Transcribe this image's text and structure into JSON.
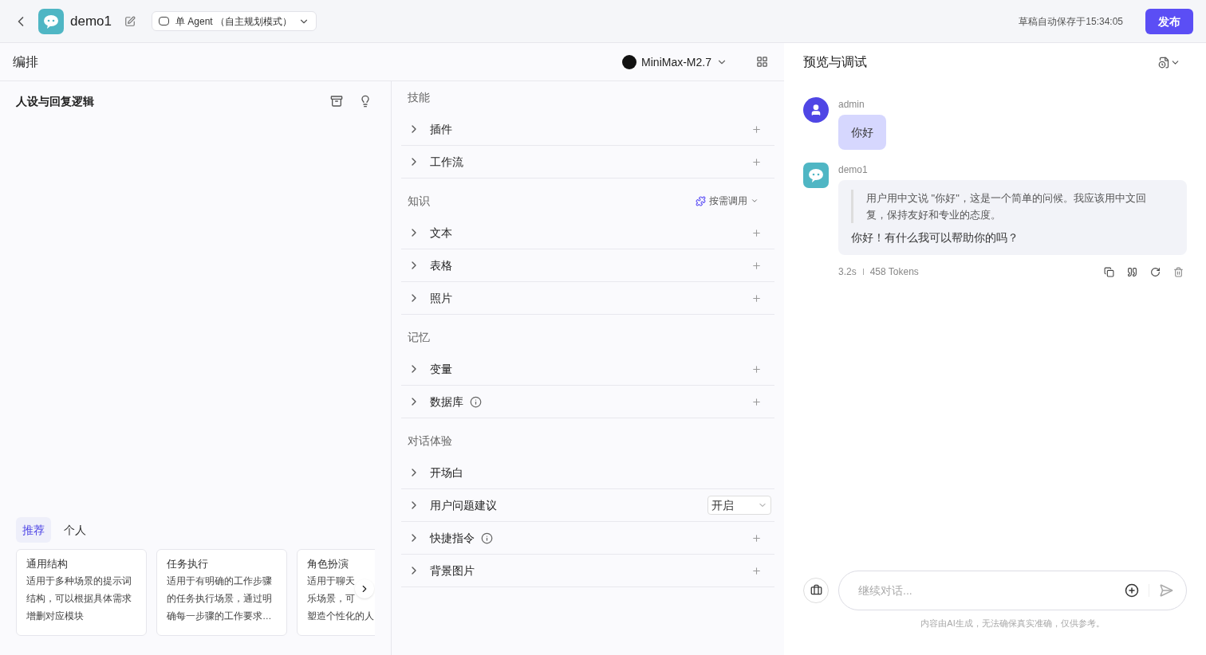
{
  "header": {
    "app_name": "demo1",
    "mode": "单 Agent （自主规划模式）",
    "autosave": "草稿自动保存于15:34:05",
    "publish": "发布"
  },
  "editor": {
    "title": "编排",
    "model": "MiniMax-M2.7"
  },
  "prompt": {
    "title": "人设与回复逻辑",
    "template_tabs": [
      {
        "label": "推荐",
        "selected": true
      },
      {
        "label": "个人",
        "selected": false
      }
    ],
    "templates": [
      {
        "title": "通用结构",
        "lines": [
          "适用于多种场景的提示词",
          "结构，可以根据具体需求",
          "增删对应模块"
        ]
      },
      {
        "title": "任务执行",
        "lines": [
          "适用于有明确的工作步骤",
          "的任务执行场景，通过明",
          "确每一步骤的工作要求…"
        ]
      },
      {
        "title": "角色扮演",
        "lines": [
          "适用于聊天",
          "乐场景，可",
          "塑造个性化的人"
        ]
      }
    ]
  },
  "sections": [
    {
      "title": "技能",
      "items": [
        {
          "label": "插件",
          "kind": "add",
          "info": false
        },
        {
          "label": "工作流",
          "kind": "add",
          "info": false
        }
      ]
    },
    {
      "title": "知识",
      "action": "按需调用",
      "items": [
        {
          "label": "文本",
          "kind": "add",
          "info": false
        },
        {
          "label": "表格",
          "kind": "add",
          "info": false
        },
        {
          "label": "照片",
          "kind": "add",
          "info": false
        }
      ]
    },
    {
      "title": "记忆",
      "items": [
        {
          "label": "变量",
          "kind": "add",
          "info": false
        },
        {
          "label": "数据库",
          "kind": "add",
          "info": true
        }
      ]
    },
    {
      "title": "对话体验",
      "items": [
        {
          "label": "开场白",
          "kind": "plain",
          "info": false
        },
        {
          "label": "用户问题建议",
          "kind": "select",
          "info": false,
          "value": "开启"
        },
        {
          "label": "快捷指令",
          "kind": "add",
          "info": true
        },
        {
          "label": "背景图片",
          "kind": "add",
          "info": false
        }
      ]
    }
  ],
  "preview": {
    "title": "预览与调试",
    "messages": [
      {
        "kind": "user",
        "sender": "admin",
        "text": "你好"
      },
      {
        "kind": "bot",
        "sender": "demo1",
        "thinking": "用户用中文说 \"你好\"，这是一个简单的问候。我应该用中文回复，保持友好和专业的态度。",
        "text": "你好！有什么我可以帮助你的吗？",
        "time": "3.2s",
        "tokens": "458 Tokens"
      }
    ],
    "input": {
      "placeholder": "继续对话..."
    },
    "disclaimer": "内容由AI生成，无法确保真实准确，仅供参考。"
  }
}
